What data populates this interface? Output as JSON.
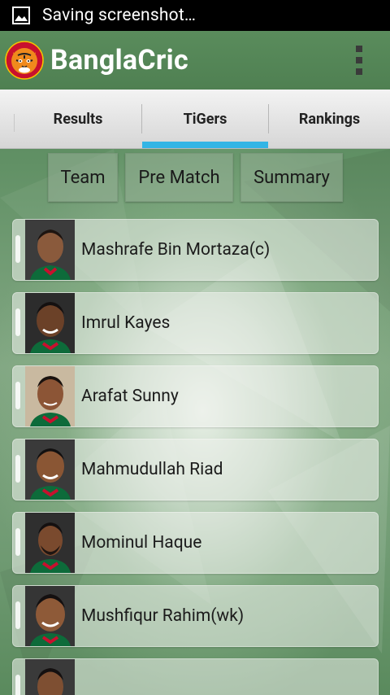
{
  "status_bar": {
    "notification_text": "Saving screenshot…"
  },
  "app": {
    "title": "BanglaCric"
  },
  "tabs": [
    {
      "label": "Results",
      "selected": false
    },
    {
      "label": "TiGers",
      "selected": true
    },
    {
      "label": "Rankings",
      "selected": false
    }
  ],
  "sub_buttons": {
    "team": "Team",
    "pre_match": "Pre Match",
    "summary": "Summary"
  },
  "players": [
    {
      "name": "Mashrafe Bin Mortaza(c)"
    },
    {
      "name": "Imrul Kayes"
    },
    {
      "name": "Arafat Sunny"
    },
    {
      "name": "Mahmudullah Riad"
    },
    {
      "name": "Mominul Haque"
    },
    {
      "name": "Mushfiqur Rahim(wk)"
    },
    {
      "name": ""
    }
  ],
  "colors": {
    "tab_indicator": "#33b5e5",
    "action_bar": "#5a8c5c"
  }
}
